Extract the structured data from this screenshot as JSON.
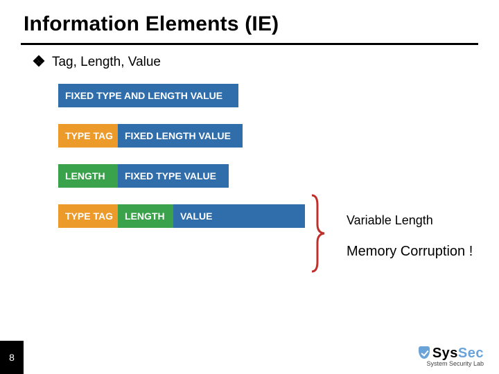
{
  "title": "Information Elements (IE)",
  "subtitle": "Tag, Length, Value",
  "rows": {
    "r1": {
      "c1": "FIXED TYPE AND LENGTH VALUE"
    },
    "r2": {
      "c1": "TYPE TAG",
      "c2": "FIXED LENGTH VALUE"
    },
    "r3": {
      "c1": "LENGTH",
      "c2": "FIXED TYPE VALUE"
    },
    "r4": {
      "c1": "TYPE TAG",
      "c2": "LENGTH",
      "c3": "VALUE"
    }
  },
  "side": {
    "variable_length": "Variable Length",
    "memory_corruption": "Memory Corruption !"
  },
  "page_number": "8",
  "logo": {
    "sys": "Sys",
    "sec": "Sec",
    "sub": "System Security Lab"
  }
}
